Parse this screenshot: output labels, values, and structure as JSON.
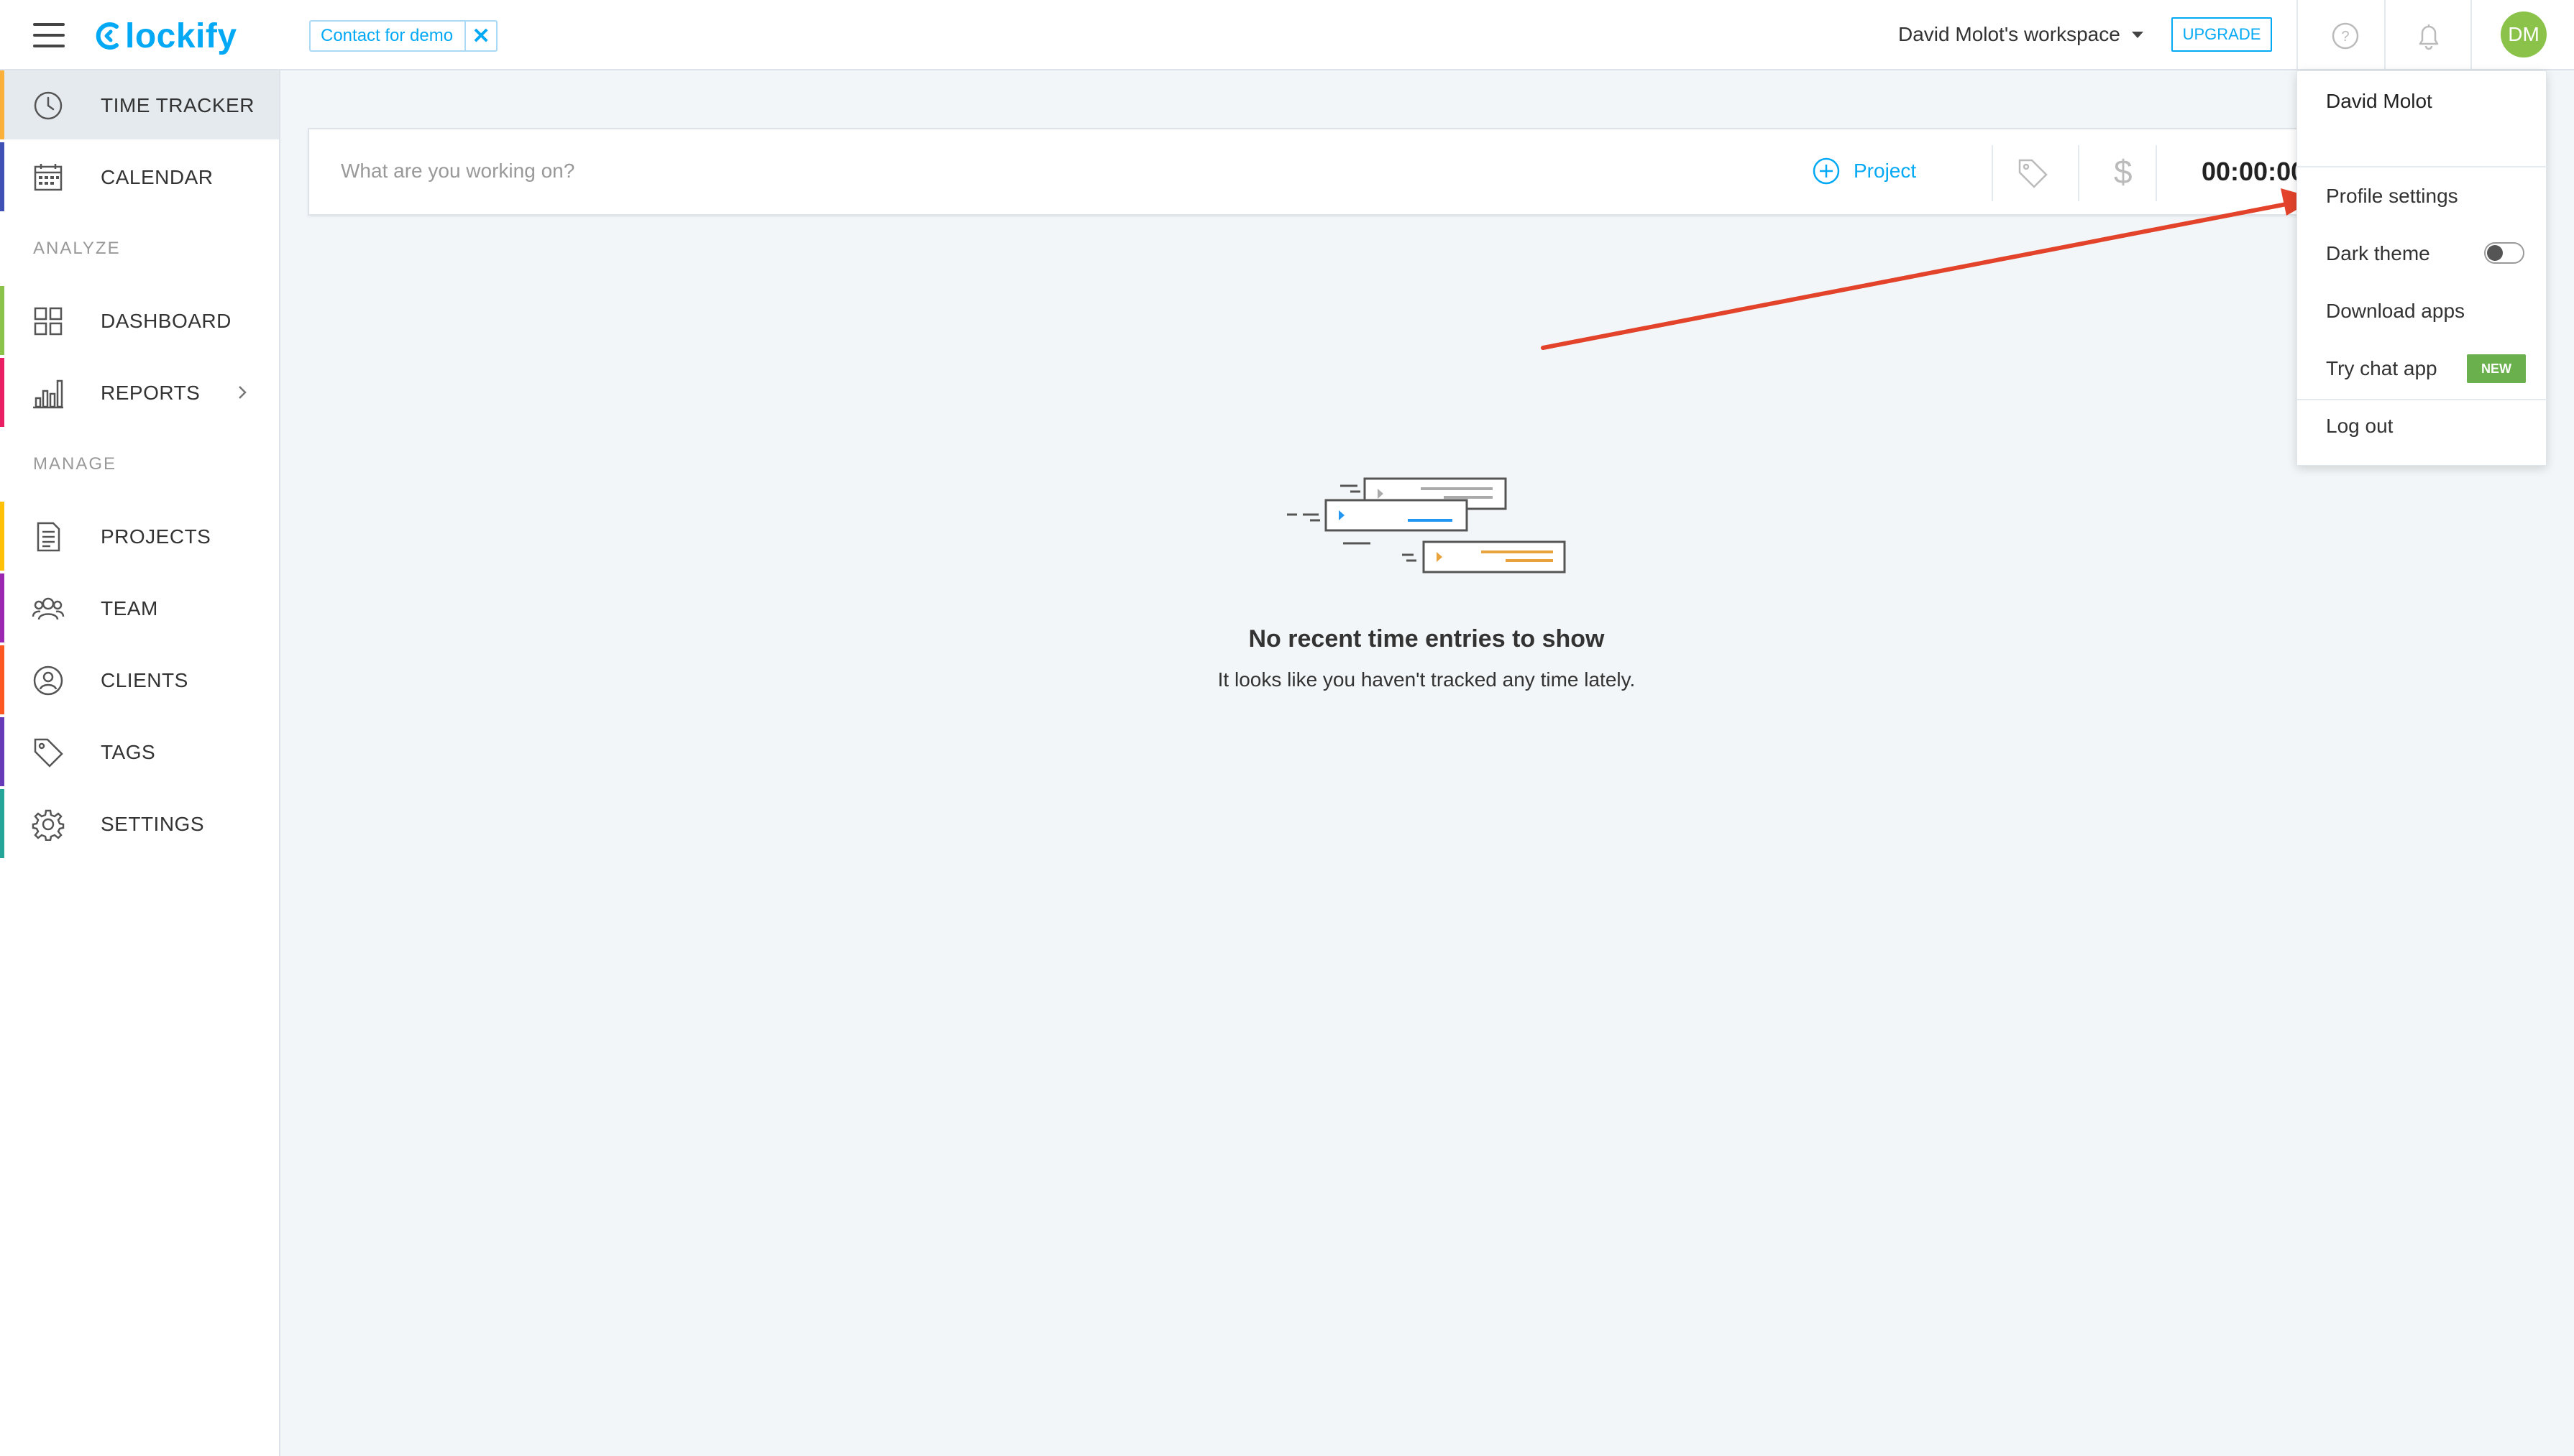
{
  "header": {
    "logo_text": "lockify",
    "demo_chip": "Contact for demo",
    "demo_close": "✕",
    "workspace": "David Molot's workspace",
    "upgrade": "UPGRADE",
    "avatar_initials": "DM"
  },
  "sidebar": {
    "items": [
      {
        "label": "TIME TRACKER",
        "icon": "clock-icon",
        "color": "#fbb03b"
      },
      {
        "label": "CALENDAR",
        "icon": "calendar-icon",
        "color": "#3f51b5"
      },
      {
        "label": "DASHBOARD",
        "icon": "dashboard-icon",
        "color": "#8bc34a"
      },
      {
        "label": "REPORTS",
        "icon": "bar-chart-icon",
        "color": "#e91e63"
      },
      {
        "label": "PROJECTS",
        "icon": "document-icon",
        "color": "#ffc107"
      },
      {
        "label": "TEAM",
        "icon": "users-icon",
        "color": "#9c27b0"
      },
      {
        "label": "CLIENTS",
        "icon": "client-icon",
        "color": "#ff5722"
      },
      {
        "label": "TAGS",
        "icon": "tag-icon",
        "color": "#673ab7"
      },
      {
        "label": "SETTINGS",
        "icon": "gear-icon",
        "color": "#26a69a"
      }
    ],
    "section_analyze": "ANALYZE",
    "section_manage": "MANAGE"
  },
  "timer": {
    "placeholder": "What are you working on?",
    "project_label": "Project",
    "dollar": "$",
    "time": "00:00:00"
  },
  "empty_state": {
    "title": "No recent time entries to show",
    "subtitle": "It looks like you haven't tracked any time lately."
  },
  "profile_menu": {
    "name": "David Molot",
    "profile_settings": "Profile settings",
    "dark_theme": "Dark theme",
    "dark_theme_on": false,
    "download_apps": "Download apps",
    "try_chat_app": "Try chat app",
    "new_badge": "NEW",
    "log_out": "Log out"
  },
  "colors": {
    "brand": "#03a9f4",
    "annotation_arrow": "#e2432a",
    "avatar": "#8bc34a",
    "new_badge": "#6ab04c"
  }
}
